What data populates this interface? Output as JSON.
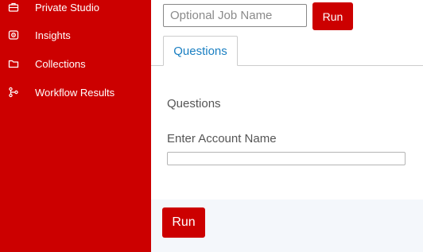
{
  "sidebar": {
    "items": [
      {
        "label": "Private Studio",
        "icon": "briefcase-icon"
      },
      {
        "label": "Insights",
        "icon": "eye-icon"
      },
      {
        "label": "Collections",
        "icon": "folder-icon"
      },
      {
        "label": "Workflow Results",
        "icon": "workflow-icon"
      }
    ]
  },
  "job": {
    "placeholder": "Optional Job Name",
    "run_label": "Run"
  },
  "tabs": [
    {
      "label": "Questions",
      "active": true
    }
  ],
  "questions": {
    "title": "Questions",
    "fields": [
      {
        "label": "Enter Account Name",
        "value": ""
      }
    ]
  },
  "footer": {
    "run_label": "Run"
  },
  "colors": {
    "brand_red": "#cc0000",
    "tab_text": "#1a7fc2",
    "footer_bg": "#f4f7fb"
  }
}
